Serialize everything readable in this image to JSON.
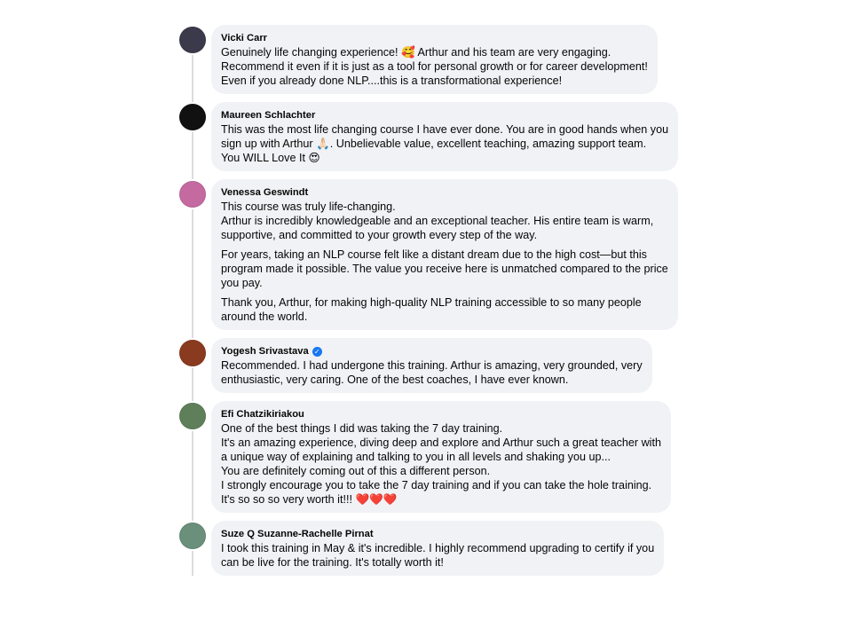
{
  "colors": {
    "bubble_bg": "#f0f2f5",
    "rail": "#dadde1",
    "verified_badge": "#1877f2"
  },
  "comments": [
    {
      "author": "Vicki Carr",
      "avatar_icon": "night-cityscape-avatar",
      "avatar_color": "#3a3a4a",
      "verified": false,
      "paragraphs": [
        "Genuinely life changing experience! 🥰 Arthur and his team are very engaging.\nRecommend it even if it is just as a tool for personal growth or for career development!\nEven if you already done NLP....this is a transformational experience!"
      ]
    },
    {
      "author": "Maureen Schlachter",
      "avatar_icon": "script-logo-avatar",
      "avatar_color": "#111111",
      "verified": false,
      "paragraphs": [
        "This was the most life changing course I have ever done. You are in good hands when you\nsign up with Arthur 🙏🏻. Unbelievable value, excellent teaching, amazing support team.\nYou WILL Love It 😍"
      ]
    },
    {
      "author": "Venessa Geswindt",
      "avatar_icon": "portrait-avatar",
      "avatar_color": "#c46aa0",
      "verified": false,
      "paragraphs": [
        "This course was truly life-changing.\nArthur is incredibly knowledgeable and an exceptional teacher. His entire team is warm,\nsupportive, and committed to your growth every step of the way.",
        "For years, taking an NLP course felt like a distant dream due to the high cost—but this\nprogram made it possible. The value you receive here is unmatched compared to the price\nyou pay.",
        "Thank you, Arthur, for making high-quality NLP training accessible to so many people\naround the world."
      ]
    },
    {
      "author": "Yogesh Srivastava",
      "avatar_icon": "portrait-avatar",
      "avatar_color": "#8a3a1e",
      "verified": true,
      "verified_glyph": "✓",
      "paragraphs": [
        "Recommended. I had undergone this training. Arthur is amazing, very grounded, very\nenthusiastic, very caring. One of the best coaches, I have ever known."
      ]
    },
    {
      "author": "Efi Chatzikiriakou",
      "avatar_icon": "outdoor-photo-avatar",
      "avatar_color": "#5f7f5a",
      "verified": false,
      "paragraphs": [
        "One of the best things I did was taking the 7 day training.\nIt's an amazing experience, diving deep and explore and Arthur such a great teacher with\na unique way of explaining and talking to you in all levels and shaking you up...\nYou are definitely coming out of this a different person.\nI strongly encourage you to take the 7 day training and if you can take the hole training.\nIt's so so so very worth it!!! ❤️❤️❤️"
      ]
    },
    {
      "author": "Suze Q Suzanne-Rachelle Pirnat",
      "avatar_icon": "portrait-avatar",
      "avatar_color": "#6a8f7a",
      "verified": false,
      "paragraphs": [
        "I took this training in May & it's incredible. I highly recommend upgrading to certify if you\ncan be live for the training. It's totally worth it!"
      ]
    }
  ]
}
